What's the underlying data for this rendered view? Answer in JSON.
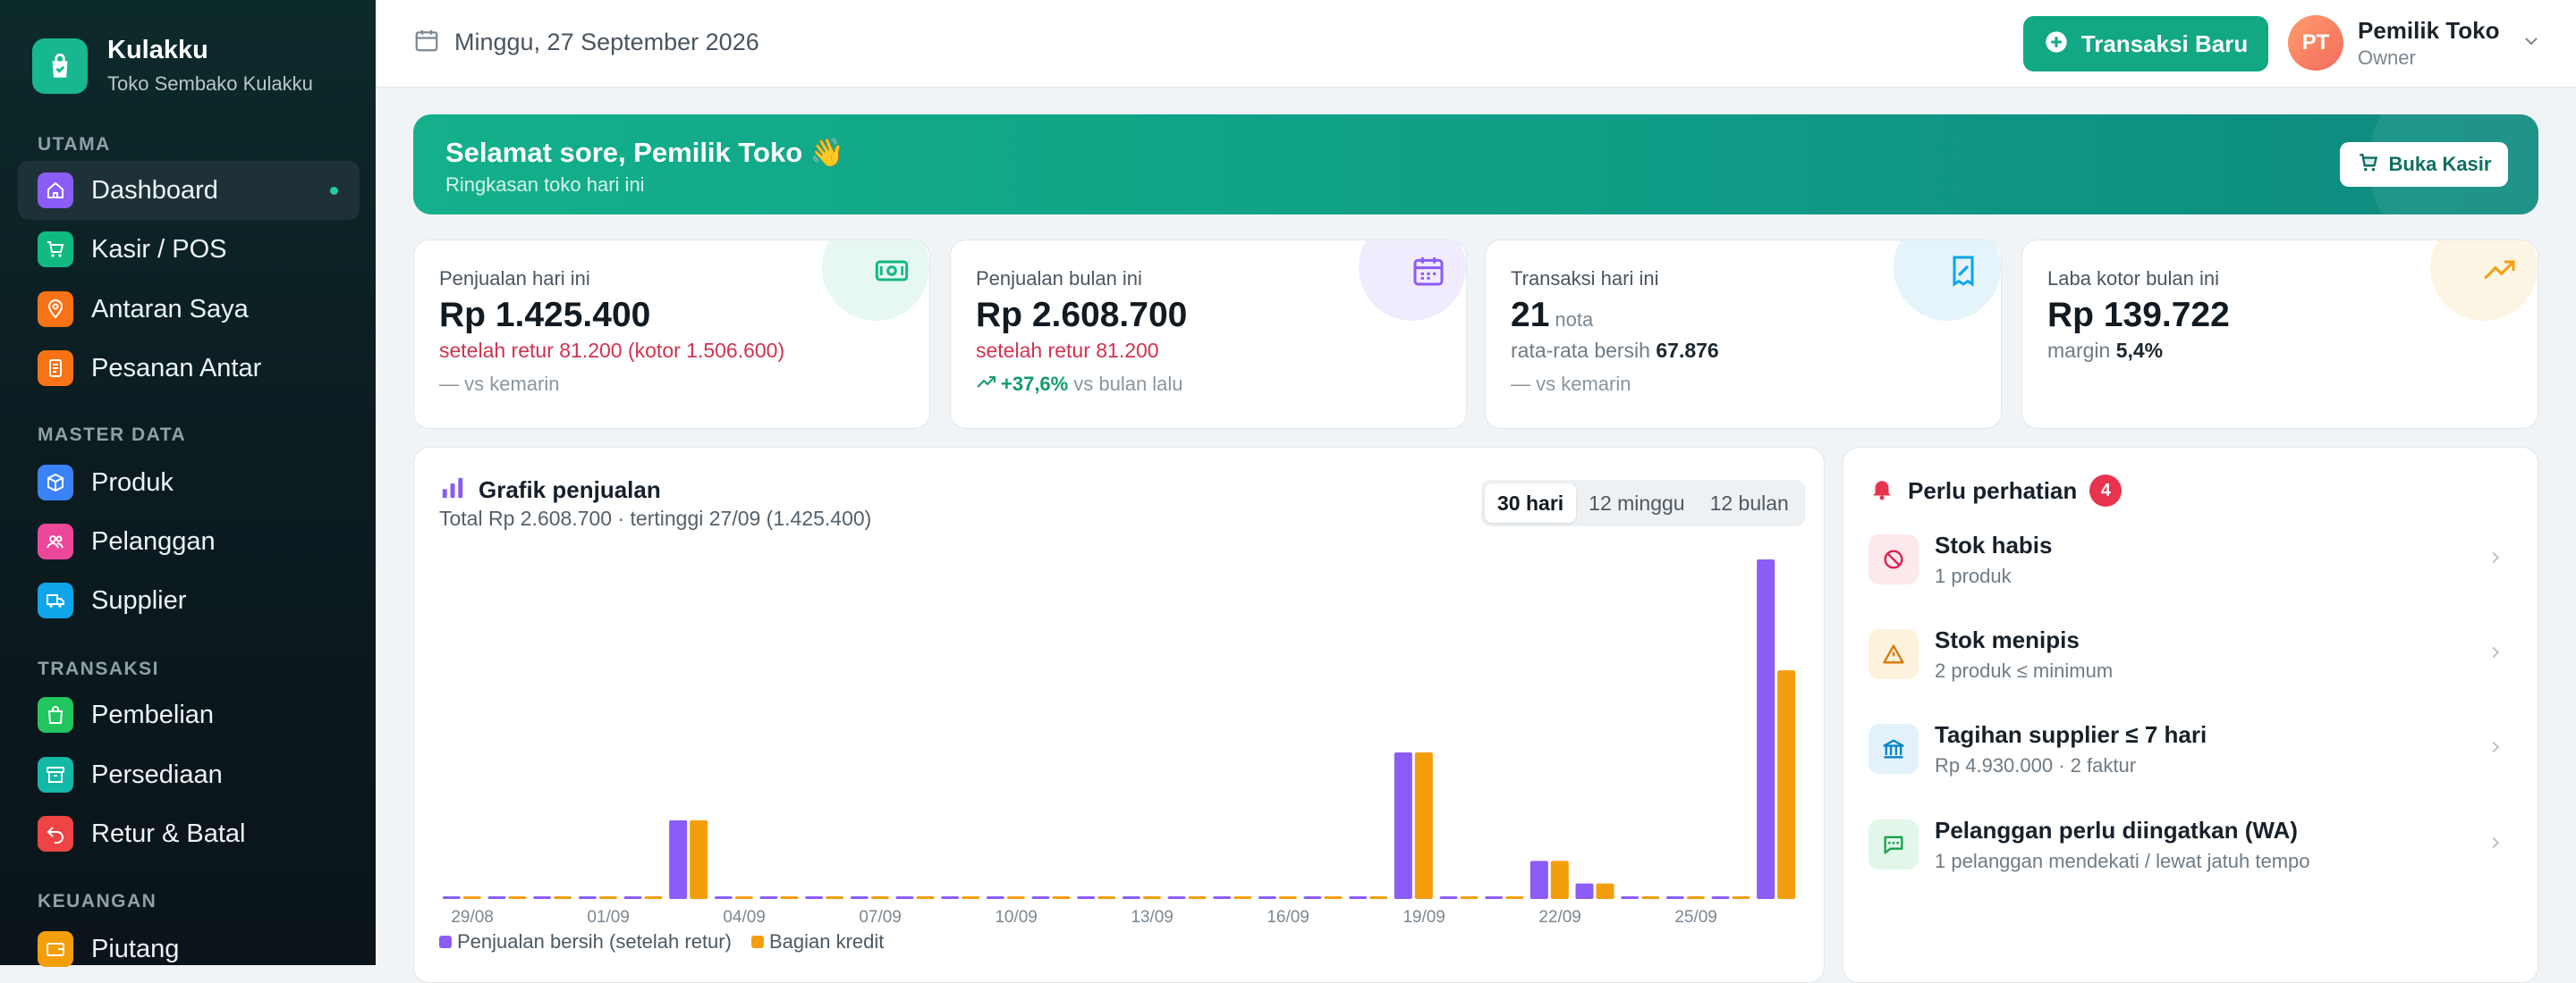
{
  "brand": {
    "name": "Kulakku",
    "store": "Toko Sembako Kulakku"
  },
  "sidebar": {
    "sections": [
      {
        "title": "UTAMA",
        "items": [
          {
            "label": "Dashboard",
            "icon": "home-icon",
            "color": "#8b5cf6",
            "active": true
          },
          {
            "label": "Kasir / POS",
            "icon": "cart-icon",
            "color": "#10b981"
          },
          {
            "label": "Antaran Saya",
            "icon": "map-pin-icon",
            "color": "#f97316"
          },
          {
            "label": "Pesanan Antar",
            "icon": "document-icon",
            "color": "#f97316"
          }
        ]
      },
      {
        "title": "MASTER DATA",
        "items": [
          {
            "label": "Produk",
            "icon": "box-icon",
            "color": "#3b82f6"
          },
          {
            "label": "Pelanggan",
            "icon": "users-icon",
            "color": "#ec4899"
          },
          {
            "label": "Supplier",
            "icon": "truck-icon",
            "color": "#0ea5e9"
          }
        ]
      },
      {
        "title": "TRANSAKSI",
        "items": [
          {
            "label": "Pembelian",
            "icon": "bag-icon",
            "color": "#22c55e"
          },
          {
            "label": "Persediaan",
            "icon": "archive-icon",
            "color": "#14b8a6"
          },
          {
            "label": "Retur & Batal",
            "icon": "undo-icon",
            "color": "#ef4444"
          }
        ]
      },
      {
        "title": "KEUANGAN",
        "items": [
          {
            "label": "Piutang",
            "icon": "wallet-icon",
            "color": "#f59e0b"
          }
        ]
      }
    ]
  },
  "topbar": {
    "date": "Minggu, 27 September 2026",
    "new_transaction": "Transaksi Baru",
    "user_initials": "PT",
    "user_name": "Pemilik Toko",
    "user_role": "Owner"
  },
  "banner": {
    "greeting": "Selamat sore, Pemilik Toko 👋",
    "subtitle": "Ringkasan toko hari ini",
    "cashier_button": "Buka Kasir"
  },
  "stats": [
    {
      "label": "Penjualan hari ini",
      "value": "Rp 1.425.400",
      "line1": "setelah retur 81.200 (kotor 1.506.600)",
      "line2": "— vs kemarin",
      "icon": "cash-icon",
      "color": "#10b981"
    },
    {
      "label": "Penjualan bulan ini",
      "value": "Rp 2.608.700",
      "line1": "setelah retur 81.200",
      "trend": "+37,6%",
      "line2": "vs bulan lalu",
      "icon": "calendar-icon",
      "color": "#8b5cf6"
    },
    {
      "label": "Transaksi hari ini",
      "value": "21",
      "unit": "nota",
      "line1_prefix": "rata-rata bersih",
      "line1_value": "67.876",
      "line2": "— vs kemarin",
      "icon": "receipt-icon",
      "color": "#0ea5e9"
    },
    {
      "label": "Laba kotor bulan ini",
      "value": "Rp 139.722",
      "line1_prefix": "margin",
      "line1_value": "5,4%",
      "icon": "trend-up-icon",
      "color": "#f59e0b"
    }
  ],
  "chart": {
    "title": "Grafik penjualan",
    "subtitle": "Total Rp 2.608.700 · tertinggi 27/09 (1.425.400)",
    "ranges": [
      "30 hari",
      "12 minggu",
      "12 bulan"
    ],
    "active_range": "30 hari"
  },
  "chart_data": {
    "type": "bar",
    "categories": [
      "29/08",
      "30/08",
      "31/08",
      "01/09",
      "02/09",
      "03/09",
      "04/09",
      "05/09",
      "06/09",
      "07/09",
      "08/09",
      "09/09",
      "10/09",
      "11/09",
      "12/09",
      "13/09",
      "14/09",
      "15/09",
      "16/09",
      "17/09",
      "18/09",
      "19/09",
      "20/09",
      "21/09",
      "22/09",
      "23/09",
      "24/09",
      "25/09",
      "26/09",
      "27/09"
    ],
    "tick_labels": [
      "29/08",
      "01/09",
      "04/09",
      "07/09",
      "10/09",
      "13/09",
      "16/09",
      "19/09",
      "22/09",
      "25/09"
    ],
    "series": [
      {
        "name": "Penjualan bersih (setelah retur)",
        "color": "#8b5cf6",
        "values": [
          0,
          0,
          0,
          0,
          0,
          330000,
          0,
          0,
          0,
          0,
          0,
          0,
          0,
          0,
          0,
          0,
          0,
          0,
          0,
          0,
          0,
          615000,
          0,
          0,
          160000,
          65000,
          0,
          0,
          0,
          1425400
        ]
      },
      {
        "name": "Bagian kredit",
        "color": "#f59e0b",
        "values": [
          0,
          0,
          0,
          0,
          0,
          330000,
          0,
          0,
          0,
          0,
          0,
          0,
          0,
          0,
          0,
          0,
          0,
          0,
          0,
          0,
          0,
          615000,
          0,
          0,
          160000,
          65000,
          0,
          0,
          0,
          960000
        ]
      }
    ],
    "ylim": [
      0,
      1425400
    ],
    "grid": false,
    "legend_position": "bottom-left"
  },
  "alerts": {
    "title": "Perlu perhatian",
    "count": "4",
    "items": [
      {
        "title": "Stok habis",
        "sub": "1 produk",
        "icon": "ban-icon",
        "bg": "#fde8ec",
        "color": "#e11d48"
      },
      {
        "title": "Stok menipis",
        "sub": "2 produk ≤ minimum",
        "icon": "warning-icon",
        "bg": "#fdf3dc",
        "color": "#d97706"
      },
      {
        "title": "Tagihan supplier ≤ 7 hari",
        "sub": "Rp 4.930.000 · 2 faktur",
        "icon": "bank-icon",
        "bg": "#e3f1fb",
        "color": "#0284c7"
      },
      {
        "title": "Pelanggan perlu diingatkan (WA)",
        "sub": "1 pelanggan mendekati / lewat jatuh tempo",
        "icon": "chat-icon",
        "bg": "#e2f6ea",
        "color": "#16a34a"
      }
    ]
  }
}
